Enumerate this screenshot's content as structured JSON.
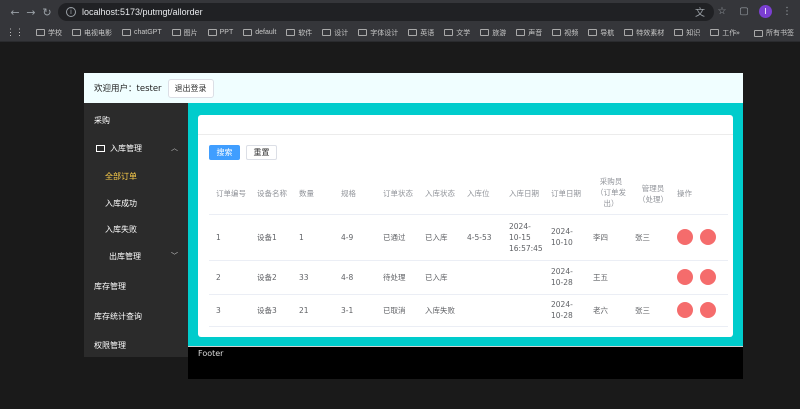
{
  "browser": {
    "url": "localhost:5173/putmgt/allorder",
    "profile_initial": "I",
    "bookmarks": [
      "学校",
      "电视电影",
      "chatGPT",
      "图片",
      "PPT",
      "default",
      "软件",
      "设计",
      "字体设计",
      "英语",
      "文学",
      "旅游",
      "声音",
      "视频",
      "导航",
      "特效素材",
      "知识",
      "工作"
    ],
    "bookmarks_more": "»",
    "all_bookmarks": "所有书签"
  },
  "header": {
    "welcome": "欢迎用户：tester",
    "logout": "退出登录"
  },
  "sidebar": {
    "items": [
      {
        "label": "采购",
        "active": false
      },
      {
        "label": "入库管理",
        "active": false
      },
      {
        "label": "全部订单",
        "active": true
      },
      {
        "label": "入库成功",
        "active": false
      },
      {
        "label": "入库失败",
        "active": false
      },
      {
        "label": "出库管理",
        "active": false
      },
      {
        "label": "库存管理",
        "active": false
      },
      {
        "label": "库存统计查询",
        "active": false
      },
      {
        "label": "权限管理",
        "active": false
      }
    ]
  },
  "toolbar": {
    "search": "搜索",
    "reset": "重置"
  },
  "table": {
    "headers": [
      "订单编号",
      "设备名称",
      "数量",
      "规格",
      "订单状态",
      "入库状态",
      "入库位",
      "入库日期",
      "订单日期",
      "采购员（订单发出）",
      "管理员（处理）",
      "操作"
    ],
    "header_lines": [
      [
        "订单编号"
      ],
      [
        "设备名称"
      ],
      [
        "数量"
      ],
      [
        "规格"
      ],
      [
        "订单状态"
      ],
      [
        "入库状态"
      ],
      [
        "入库位"
      ],
      [
        "入库日期"
      ],
      [
        "订单日期"
      ],
      [
        "采购员",
        "（订单发",
        "出）"
      ],
      [
        "管理员",
        "（处理）"
      ],
      [
        "操作"
      ]
    ],
    "rows": [
      {
        "id": "1",
        "device": "设备1",
        "qty": "1",
        "spec": "4-9",
        "order_status": "已通过",
        "stock_status": "已入库",
        "location": "4-5-53",
        "in_date_lines": [
          "2024-",
          "10-15",
          "16:57:45"
        ],
        "order_date_lines": [
          "2024-",
          "10-10"
        ],
        "buyer": "李四",
        "admin": "张三"
      },
      {
        "id": "2",
        "device": "设备2",
        "qty": "33",
        "spec": "4-8",
        "order_status": "待处理",
        "stock_status": "已入库",
        "location": "",
        "in_date_lines": [],
        "order_date_lines": [
          "2024-",
          "10-28"
        ],
        "buyer": "王五",
        "admin": ""
      },
      {
        "id": "3",
        "device": "设备3",
        "qty": "21",
        "spec": "3-1",
        "order_status": "已取消",
        "stock_status": "入库失败",
        "location": "",
        "in_date_lines": [],
        "order_date_lines": [
          "2024-",
          "10-28"
        ],
        "buyer": "老六",
        "admin": "张三"
      }
    ]
  },
  "footer": {
    "label": "Footer"
  },
  "colors": {
    "accent": "#409eff",
    "danger": "#f56c6c",
    "content_bg": "#00cccc",
    "header_bg": "#f0feff",
    "sidebar_bg": "#2b2b2b",
    "active_menu": "#ffd04b"
  }
}
